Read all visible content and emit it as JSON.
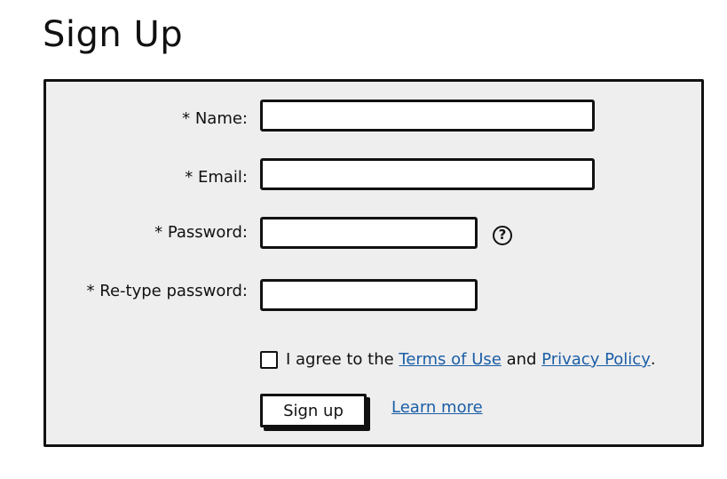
{
  "page": {
    "title": "Sign Up"
  },
  "form": {
    "fields": [
      {
        "label": "* Name:",
        "value": ""
      },
      {
        "label": "* Email:",
        "value": ""
      },
      {
        "label": "* Password:",
        "value": ""
      },
      {
        "label": "* Re-type password:",
        "value": ""
      }
    ],
    "password_help_icon": "question-circle-icon",
    "help_glyph": "?",
    "agree": {
      "checked": false,
      "prefix": "I agree to the ",
      "terms_link": "Terms of Use",
      "middle": " and ",
      "privacy_link": "Privacy Policy",
      "suffix": "."
    },
    "submit_label": "Sign up",
    "learn_more_link": "Learn more"
  },
  "colors": {
    "panel_background": "#eeeeee",
    "link": "#1b5ea6",
    "border": "#111111"
  }
}
